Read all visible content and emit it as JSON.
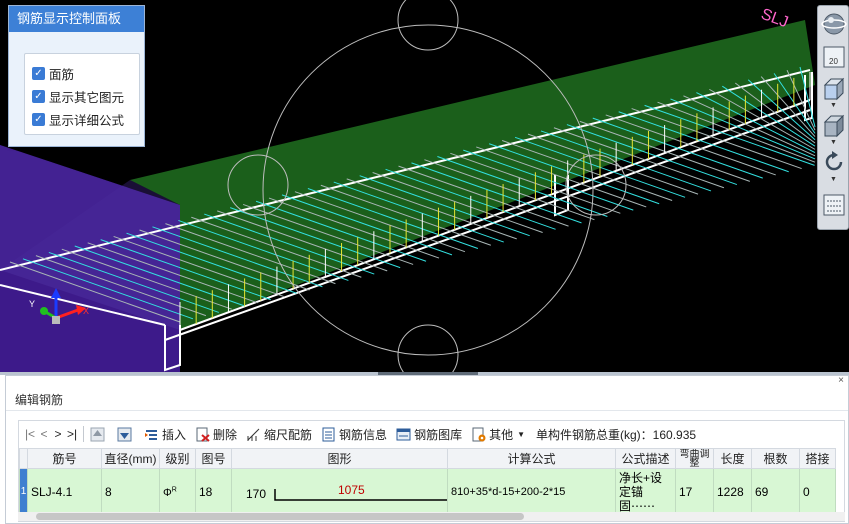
{
  "control_panel": {
    "title": "钢筋显示控制面板",
    "options": [
      {
        "label": "面筋",
        "checked": true
      },
      {
        "label": "显示其它图元",
        "checked": true
      },
      {
        "label": "显示详细公式",
        "checked": true
      }
    ]
  },
  "right_toolbar": {
    "zoom_label": "20",
    "icons": [
      "orbit-sphere-icon",
      "zoom-box-icon",
      "view-cube-front-icon",
      "view-cube-iso-icon",
      "rotate-icon",
      "grid-settings-icon"
    ]
  },
  "bottom_panel": {
    "title": "编辑钢筋",
    "close_glyph": "×",
    "nav": [
      "|<",
      "<",
      ">",
      ">|"
    ],
    "toolbar": {
      "insert": "插入",
      "delete": "删除",
      "scale_rebar": "缩尺配筋",
      "rebar_info": "钢筋信息",
      "rebar_library": "钢筋图库",
      "other": "其他",
      "total_label": "单构件钢筋总重(kg)：160.935"
    },
    "columns": [
      "筋号",
      "直径(mm)",
      "级别",
      "图号",
      "图形",
      "计算公式",
      "公式描述",
      "弯曲调整",
      "长度",
      "根数",
      "搭接"
    ],
    "rows": [
      {
        "row_num": "1",
        "bar_id": "SLJ-4.1",
        "diameter": "8",
        "grade": "ΦR",
        "shape_no": "18",
        "shape_left": "170",
        "shape_len": "1075",
        "formula": "810+35*d-15+200-2*15",
        "desc": "净长+设定锚固⋯⋯",
        "bend_adj": "17",
        "length": "1228",
        "count": "69",
        "lap": "0"
      }
    ]
  },
  "colors": {
    "slab_green": "#1b5f1b",
    "slab_purple": "#3d1a8a",
    "rebar_cyan": "#33e0e0",
    "rebar_yellow": "#e6e633",
    "panel_blue": "#3d80d6",
    "row_green": "#d8f7d4"
  }
}
